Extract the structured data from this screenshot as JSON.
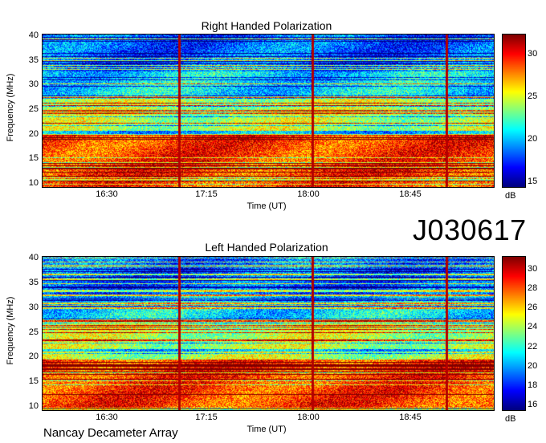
{
  "observation_id": "J030617",
  "instrument": "Nancay Decameter Array",
  "chart_data": [
    {
      "type": "heatmap",
      "title": "Right Handed Polarization",
      "xlabel": "Time (UT)",
      "ylabel": "Frequency (MHz)",
      "xticks": [
        "16:30",
        "17:15",
        "18:00",
        "18:45"
      ],
      "yticks": [
        "10",
        "15",
        "20",
        "25",
        "30",
        "35",
        "40"
      ],
      "ylim": [
        9.5,
        40.5
      ],
      "colorbar": {
        "label": "dB",
        "ticks": [
          "15",
          "20",
          "25",
          "30"
        ],
        "range": [
          14.5,
          32.5
        ]
      },
      "grid": false
    },
    {
      "type": "heatmap",
      "title": "Left Handed Polarization",
      "xlabel": "Time (UT)",
      "ylabel": "Frequency (MHz)",
      "xticks": [
        "16:30",
        "17:15",
        "18:00",
        "18:45"
      ],
      "yticks": [
        "10",
        "15",
        "20",
        "25",
        "30",
        "35",
        "40"
      ],
      "ylim": [
        9.5,
        40.5
      ],
      "colorbar": {
        "label": "dB",
        "ticks": [
          "16",
          "18",
          "20",
          "22",
          "24",
          "26",
          "28",
          "30"
        ],
        "range": [
          15.6,
          31.4
        ]
      },
      "grid": false
    }
  ]
}
